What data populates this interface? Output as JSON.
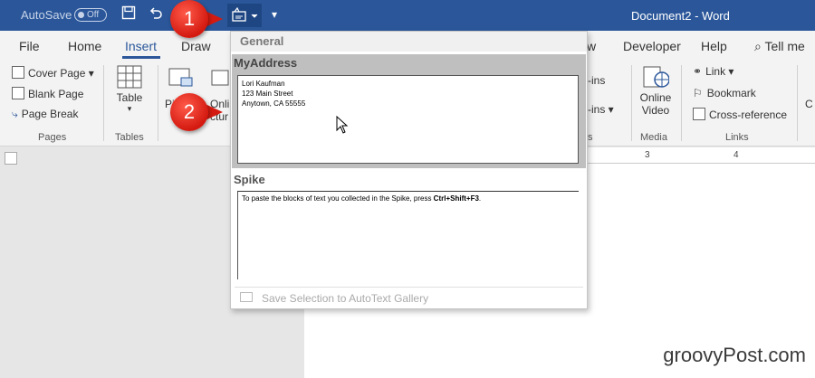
{
  "titlebar": {
    "autosave_label": "AutoSave",
    "autosave_state": "Off",
    "doc_title": "Document2 - Word"
  },
  "tabs": [
    "File",
    "Home",
    "Insert",
    "Draw",
    "w",
    "Developer",
    "Help",
    "Tell me"
  ],
  "ribbon": {
    "pages": {
      "items": [
        "Cover Page",
        "Blank Page",
        "Page Break"
      ],
      "label": "Pages"
    },
    "tables": {
      "item": "Table",
      "label": "Tables"
    },
    "partial": {
      "pi": "Pi",
      "online_pict": "Onli",
      "cture": "ctur",
      "addins1": "-ins",
      "addins2": "-ins",
      "s_label": "s"
    },
    "media": {
      "item_line1": "Online",
      "item_line2": "Video",
      "label": "Media"
    },
    "links": {
      "items": [
        "Link",
        "Bookmark",
        "Cross-reference"
      ],
      "label": "Links"
    },
    "edge": {
      "c": "C"
    }
  },
  "ruler": {
    "n3": "3",
    "n4": "4"
  },
  "dropdown": {
    "section_general": "General",
    "entry_title": "MyAddress",
    "entry_lines": [
      "Lori Kaufman",
      "123 Main Street",
      "Anytown, CA 55555"
    ],
    "spike_title": "Spike",
    "spike_text_before": "To paste the blocks of text you collected in the Spike, press ",
    "spike_keys": "Ctrl+Shift+F3",
    "spike_text_after": ".",
    "save_selection": "Save Selection to AutoText Gallery"
  },
  "callouts": [
    "1",
    "2"
  ],
  "watermark": "groovyPost.com",
  "colors": {
    "titlebar": "#2b579a",
    "callout": "#d41a10"
  }
}
